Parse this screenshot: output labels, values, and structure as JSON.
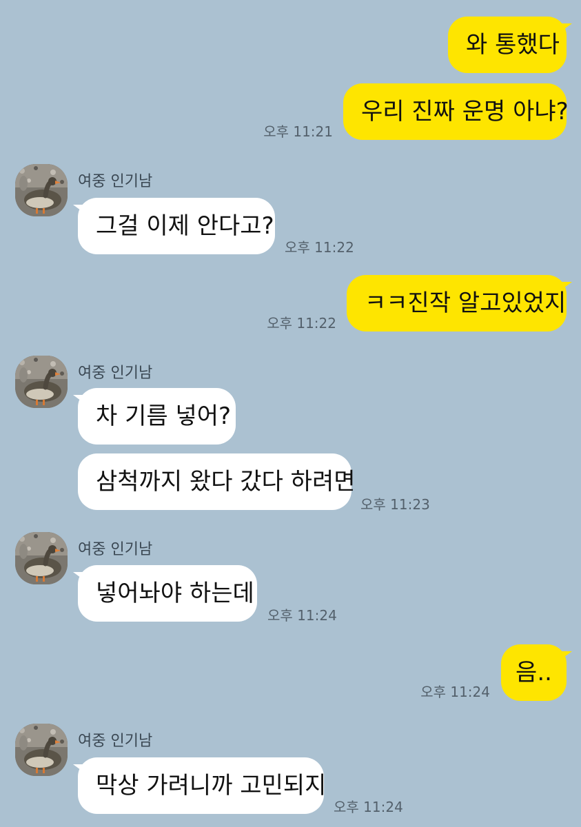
{
  "contact": {
    "name": "여중 인기남",
    "avatar_icon": "goose-photo-avatar"
  },
  "messages": [
    {
      "from": "me",
      "text": "와 통했다",
      "time": ""
    },
    {
      "from": "me",
      "text": "우리 진짜 운명 아냐?",
      "time": "오후 11:21"
    },
    {
      "from": "them",
      "text": "그걸 이제 안다고?",
      "time": "오후 11:22"
    },
    {
      "from": "me",
      "text": "ㅋㅋ진작 알고있었지",
      "time": "오후 11:22"
    },
    {
      "from": "them",
      "text": "차 기름 넣어?",
      "time": ""
    },
    {
      "from": "them",
      "text": "삼척까지 왔다 갔다 하려면",
      "time": "오후 11:23"
    },
    {
      "from": "them",
      "text": "넣어놔야 하는데",
      "time": "오후 11:24"
    },
    {
      "from": "me",
      "text": "음..",
      "time": "오후 11:24"
    },
    {
      "from": "them",
      "text": "막상 가려니까 고민되지",
      "time": "오후 11:24"
    }
  ],
  "colors": {
    "background": "#abc1d1",
    "my_bubble": "#fee500",
    "their_bubble": "#ffffff"
  }
}
